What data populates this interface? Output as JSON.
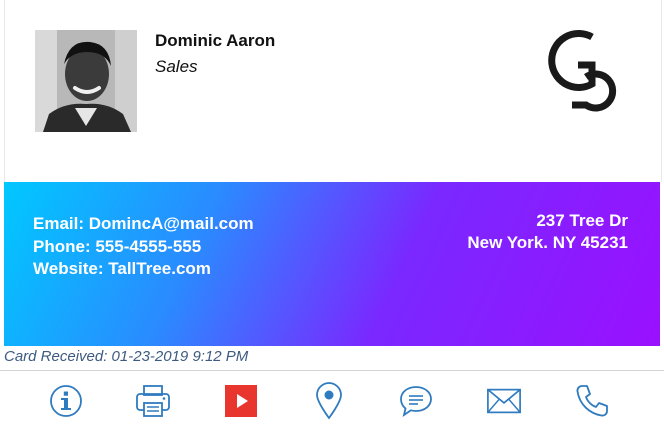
{
  "card": {
    "name": "Dominic Aaron",
    "title": "Sales",
    "contact": {
      "email_line": "Email: DomincA@mail.com",
      "phone_line": "Phone: 555-4555-555",
      "website_line": "Website: TallTree.com"
    },
    "address": {
      "line1": "237 Tree Dr",
      "line2": "New York. NY 45231"
    },
    "received_line": "Card Received: 01-23-2019 9:12 PM"
  },
  "colors": {
    "gradient_start": "#00c8ff",
    "gradient_end": "#9a10ff",
    "icon_blue": "#2f7bbf",
    "video_red": "#e8352e"
  },
  "toolbar": {
    "icons": [
      "info-icon",
      "printer-icon",
      "video-play-icon",
      "location-pin-icon",
      "chat-icon",
      "mail-icon",
      "phone-icon"
    ]
  }
}
